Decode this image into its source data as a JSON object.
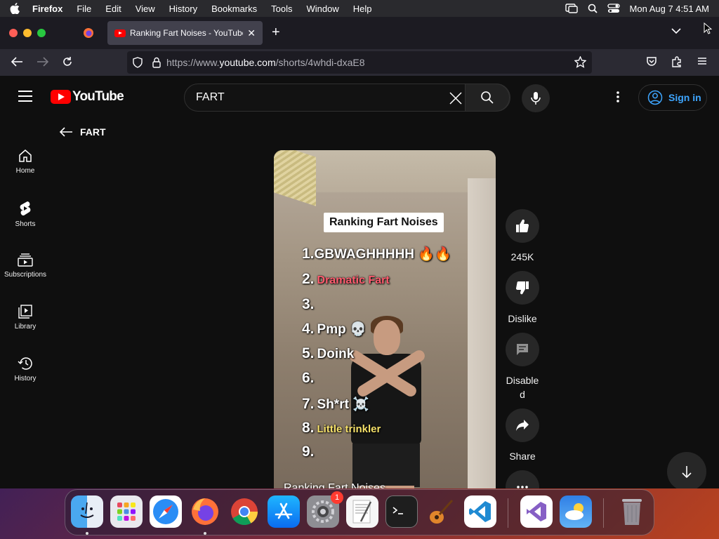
{
  "menubar": {
    "app": "Firefox",
    "items": [
      "File",
      "Edit",
      "View",
      "History",
      "Bookmarks",
      "Tools",
      "Window",
      "Help"
    ],
    "clock": "Mon Aug 7  4:51 AM"
  },
  "browser": {
    "tab_title": "Ranking Fart Noises - YouTube",
    "url_prefix": "https://www.",
    "url_domain": "youtube.com",
    "url_path": "/shorts/4whdi-dxaE8"
  },
  "youtube": {
    "logo_text": "YouTube",
    "search_value": "FART",
    "signin_label": "Sign in",
    "back_label": "FART",
    "guide": [
      {
        "label": "Home",
        "icon": "home-icon"
      },
      {
        "label": "Shorts",
        "icon": "shorts-icon"
      },
      {
        "label": "Subscriptions",
        "icon": "subscriptions-icon"
      },
      {
        "label": "Library",
        "icon": "library-icon"
      },
      {
        "label": "History",
        "icon": "history-icon"
      }
    ],
    "short": {
      "card_title": "Ranking Fart Noises",
      "caption": "Ranking Fart Noises",
      "ranks": [
        {
          "n": "1.",
          "text": "GBWAGHHHHH 🔥🔥"
        },
        {
          "n": "2.",
          "text": "Dramatic Fart"
        },
        {
          "n": "3.",
          "text": ""
        },
        {
          "n": "4.",
          "text": "Pmp 💀"
        },
        {
          "n": "5.",
          "text": "Doink"
        },
        {
          "n": "6.",
          "text": ""
        },
        {
          "n": "7.",
          "text": "Sh*rt ☠️"
        },
        {
          "n": "8.",
          "text": "Little trinkler"
        },
        {
          "n": "9.",
          "text": ""
        }
      ]
    },
    "actions": {
      "like_count": "245K",
      "dislike_label": "Dislike",
      "comments_label": "Disable d",
      "share_label": "Share"
    }
  },
  "dock": {
    "apps": [
      "Finder",
      "Launchpad",
      "Safari",
      "Firefox",
      "Chrome",
      "App Store",
      "System Settings",
      "TextEdit",
      "Terminal",
      "GarageBand",
      "VS Code",
      "Visual Studio",
      "Weather",
      "Trash"
    ],
    "settings_badge": "1"
  }
}
